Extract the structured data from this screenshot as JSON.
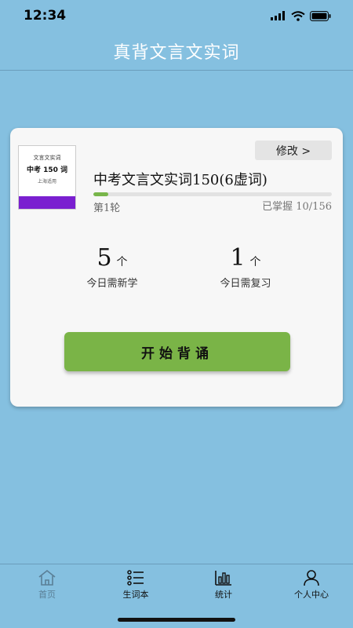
{
  "status_bar": {
    "time": "12:34"
  },
  "header": {
    "title": "真背文言文实词"
  },
  "book": {
    "cover": {
      "line1": "文言文实词",
      "line2": "中考 150 词",
      "line3": "上海适用"
    },
    "edit_label": "修改 >",
    "title": "中考文言文实词150(6虚词)",
    "round_label": "第1轮",
    "mastered_label": "已掌握 10/156",
    "mastered_count": 10,
    "total_count": 156
  },
  "stats": {
    "new": {
      "number": "5",
      "unit": "个",
      "label": "今日需新学"
    },
    "review": {
      "number": "1",
      "unit": "个",
      "label": "今日需复习"
    }
  },
  "start_button": {
    "label": "开始背诵"
  },
  "tabs": [
    {
      "label": "首页",
      "icon": "home-icon"
    },
    {
      "label": "生词本",
      "icon": "list-icon"
    },
    {
      "label": "统计",
      "icon": "bar-chart-icon"
    },
    {
      "label": "个人中心",
      "icon": "user-icon"
    }
  ],
  "colors": {
    "background": "#85c0e0",
    "accent_green": "#7ab447",
    "cover_band": "#7a1fd0"
  }
}
